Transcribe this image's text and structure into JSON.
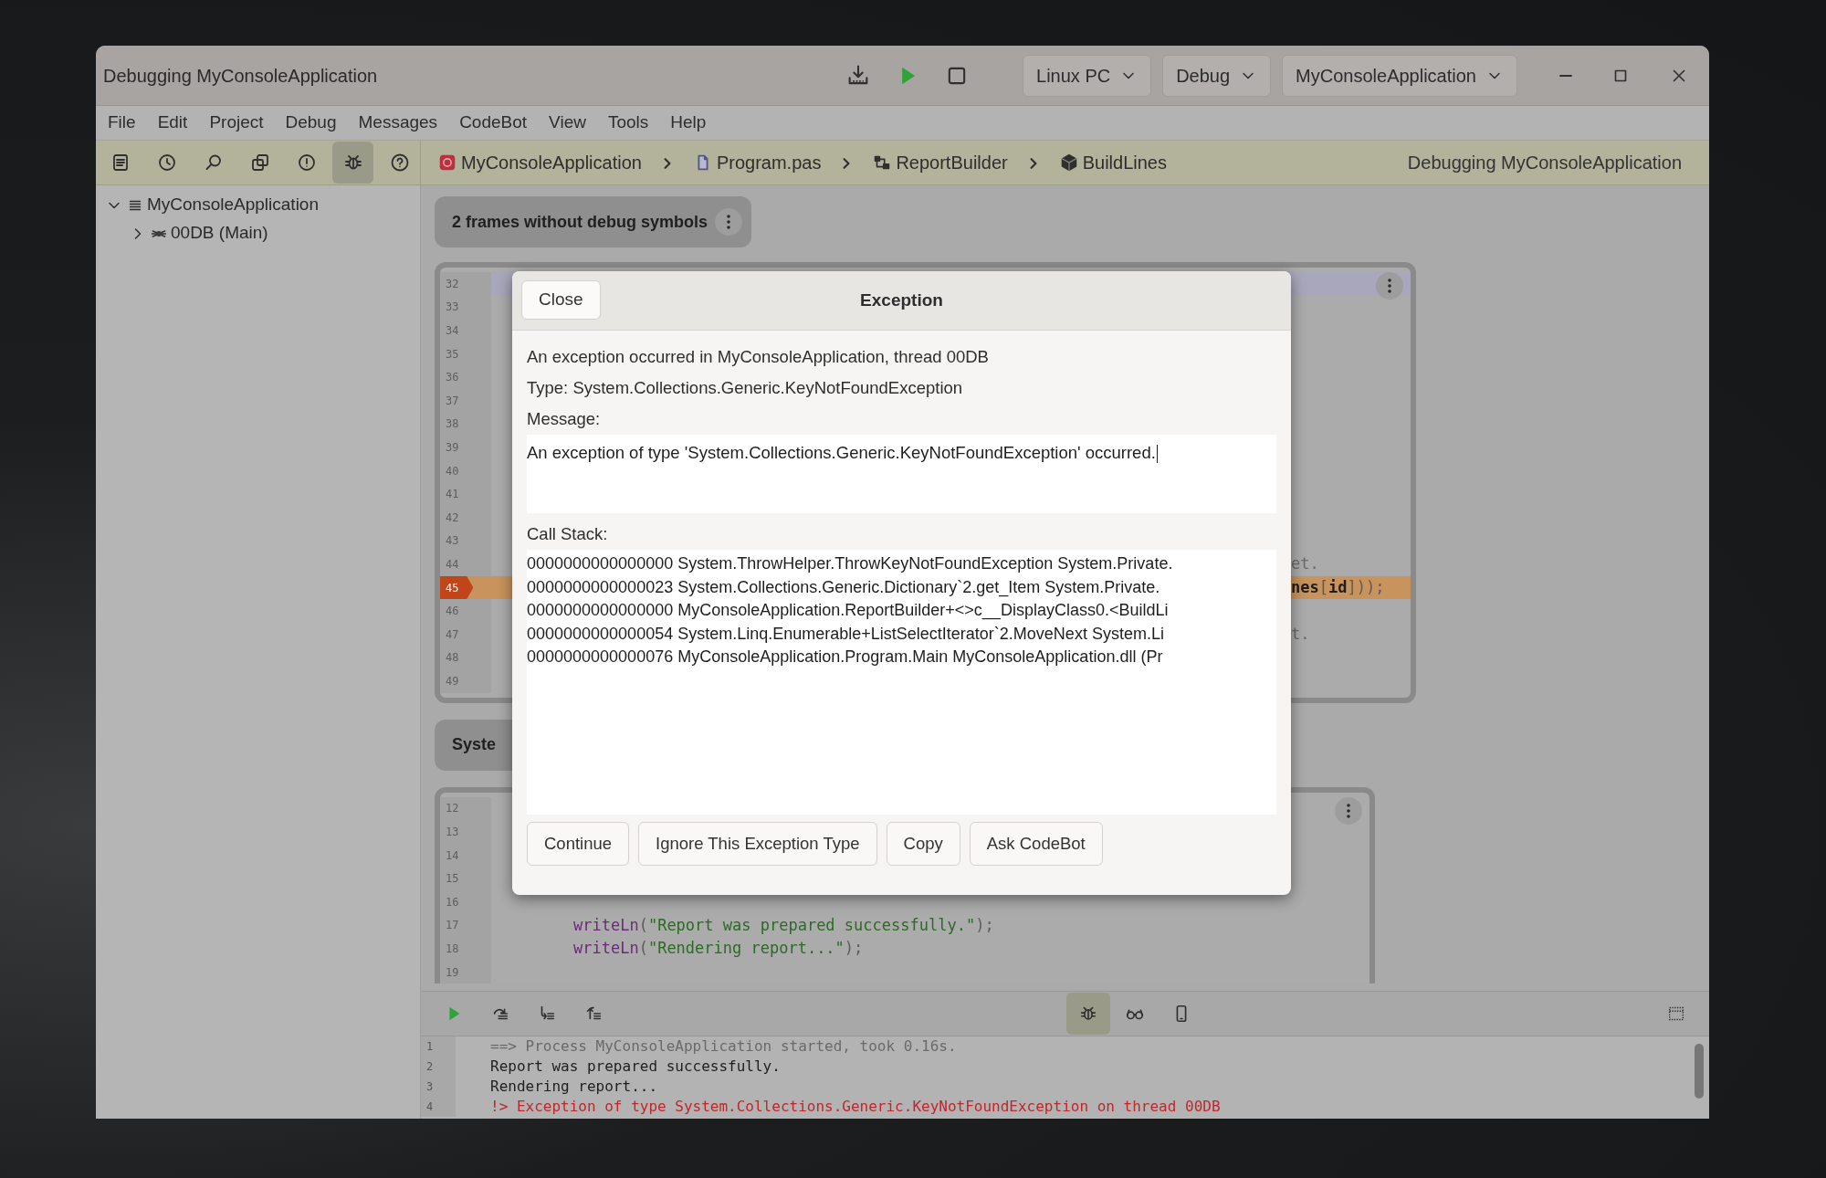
{
  "window": {
    "title": "Debugging MyConsoleApplication"
  },
  "header_actions": [
    {
      "kind": "deploy"
    },
    {
      "kind": "run"
    },
    {
      "kind": "stop"
    }
  ],
  "targets": [
    {
      "label": "Linux PC"
    },
    {
      "label": "Debug"
    },
    {
      "label": "MyConsoleApplication"
    }
  ],
  "menu": [
    "File",
    "Edit",
    "Project",
    "Debug",
    "Messages",
    "CodeBot",
    "View",
    "Tools",
    "Help"
  ],
  "tools": [
    {
      "kind": "notes",
      "selected": false
    },
    {
      "kind": "history",
      "selected": false
    },
    {
      "kind": "search",
      "selected": false
    },
    {
      "kind": "windows",
      "selected": false
    },
    {
      "kind": "issues",
      "selected": false
    },
    {
      "kind": "debug",
      "selected": true
    },
    {
      "kind": "help",
      "selected": false
    }
  ],
  "breadcrumb": [
    {
      "kind": "project",
      "label": "MyConsoleApplication"
    },
    {
      "kind": "file",
      "label": "Program.pas"
    },
    {
      "kind": "class",
      "label": "ReportBuilder"
    },
    {
      "kind": "method",
      "label": "BuildLines"
    }
  ],
  "status": "Debugging MyConsoleApplication",
  "tree": [
    {
      "kind": "project",
      "label": "MyConsoleApplication",
      "expanded": true,
      "children": [
        {
          "kind": "thread",
          "label": "00DB (Main)",
          "expanded": false
        }
      ]
    }
  ],
  "frames_notice": "2 frames without debug symbols",
  "editor_1": {
    "lines": [
      {
        "number": "32",
        "selected": true,
        "exception": false
      },
      {
        "number": "33",
        "selected": false,
        "exception": false
      },
      {
        "number": "34",
        "selected": false,
        "exception": false
      },
      {
        "number": "35",
        "selected": false,
        "exception": false
      },
      {
        "number": "36",
        "selected": false,
        "exception": false
      },
      {
        "number": "37",
        "selected": false,
        "exception": false
      },
      {
        "number": "38",
        "selected": false,
        "exception": false
      },
      {
        "number": "39",
        "selected": false,
        "exception": false
      },
      {
        "number": "40",
        "selected": false,
        "exception": false
      },
      {
        "number": "41",
        "selected": false,
        "exception": false
      },
      {
        "number": "42",
        "selected": false,
        "exception": false
      },
      {
        "number": "43",
        "selected": false,
        "exception": false
      },
      {
        "number": "44",
        "selected": false,
        "exception": false,
        "tokens": [
          {
            "kind": "comment",
            "text": "et."
          }
        ]
      },
      {
        "number": "45",
        "selected": false,
        "exception": true,
        "tokens": [
          {
            "kind": "ident",
            "text": "nes"
          },
          {
            "kind": "punct",
            "text": "["
          },
          {
            "kind": "ident",
            "text": "id"
          },
          {
            "kind": "punct",
            "text": "]));"
          }
        ]
      },
      {
        "number": "46",
        "selected": false,
        "exception": false
      },
      {
        "number": "47",
        "selected": false,
        "exception": false,
        "tokens": [
          {
            "kind": "comment",
            "text": "t."
          }
        ]
      },
      {
        "number": "48",
        "selected": false,
        "exception": false
      },
      {
        "number": "49",
        "selected": false,
        "exception": false
      }
    ]
  },
  "section_2_title": "Syste",
  "editor_2": {
    "lines": [
      {
        "number": "12"
      },
      {
        "number": "13"
      },
      {
        "number": "14"
      },
      {
        "number": "15"
      },
      {
        "number": "16"
      },
      {
        "number": "17",
        "tokens": [
          {
            "kind": "function",
            "text": "writeLn"
          },
          {
            "kind": "punct",
            "text": "("
          },
          {
            "kind": "string",
            "text": "\"Report was prepared successfully.\""
          },
          {
            "kind": "punct",
            "text": ");"
          }
        ]
      },
      {
        "number": "18",
        "tokens": [
          {
            "kind": "function",
            "text": "writeLn"
          },
          {
            "kind": "punct",
            "text": "("
          },
          {
            "kind": "string",
            "text": "\"Rendering report...\""
          },
          {
            "kind": "punct",
            "text": ");"
          }
        ]
      },
      {
        "number": "19"
      }
    ]
  },
  "debug_tools_left": [
    {
      "kind": "run",
      "selected": false
    },
    {
      "kind": "step-over",
      "selected": false
    },
    {
      "kind": "step-into",
      "selected": false
    },
    {
      "kind": "step-out",
      "selected": false
    }
  ],
  "debug_tools_center": [
    {
      "kind": "debug",
      "selected": true
    },
    {
      "kind": "watch",
      "selected": false
    },
    {
      "kind": "device",
      "selected": false
    }
  ],
  "debug_tools_right": [
    {
      "kind": "layout",
      "selected": false
    }
  ],
  "console": {
    "lines": [
      {
        "number": "1",
        "kind": "info",
        "text": "==> Process MyConsoleApplication started, took 0.16s."
      },
      {
        "number": "2",
        "kind": "output",
        "text": "Report was prepared successfully."
      },
      {
        "number": "3",
        "kind": "output",
        "text": "Rendering report..."
      },
      {
        "number": "4",
        "kind": "error",
        "text": "!> Exception of type System.Collections.Generic.KeyNotFoundException on thread 00DB"
      }
    ]
  },
  "dialog": {
    "title": "Exception",
    "close": "Close",
    "summary": "An exception occurred in MyConsoleApplication, thread 00DB",
    "type": "Type: System.Collections.Generic.KeyNotFoundException",
    "message_label": "Message:",
    "message": "An exception of type 'System.Collections.Generic.KeyNotFoundException' occurred.",
    "stack_label": "Call Stack:",
    "stack": [
      "0000000000000000 System.ThrowHelper.ThrowKeyNotFoundException System.Private.",
      "0000000000000023 System.Collections.Generic.Dictionary`2.get_Item System.Private.",
      "0000000000000000 MyConsoleApplication.ReportBuilder+<>c__DisplayClass0.<BuildLi",
      "0000000000000054 System.Linq.Enumerable+ListSelectIterator`2.MoveNext System.Li",
      "0000000000000076 MyConsoleApplication.Program.Main MyConsoleApplication.dll (Pr"
    ],
    "buttons": [
      "Continue",
      "Ignore This Exception Type",
      "Copy",
      "Ask CodeBot"
    ]
  }
}
